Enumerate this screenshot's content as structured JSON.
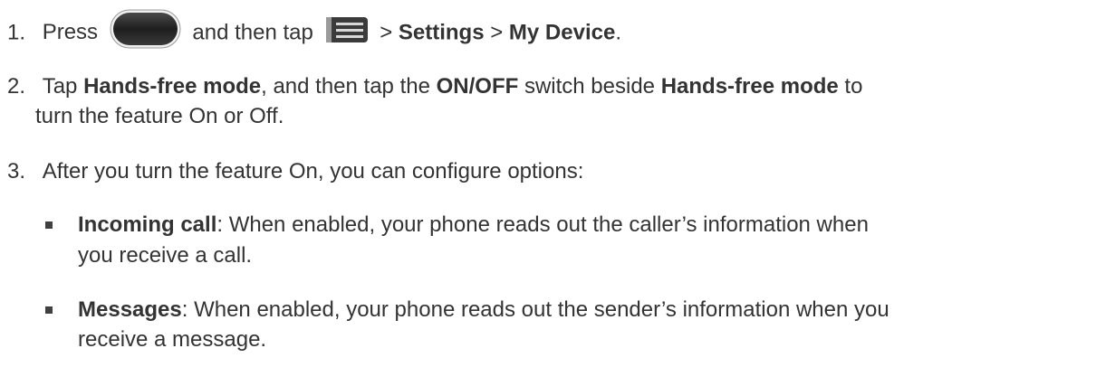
{
  "steps": [
    {
      "number": "1.",
      "seg1": "Press",
      "seg2": "and then tap",
      "seg3": ">",
      "settings": "Settings",
      "seg4": ">",
      "my_device": "My Device",
      "seg5": "."
    },
    {
      "number": "2.",
      "seg1": "Tap",
      "hands_free_mode_1": "Hands-free mode",
      "seg2": ", and then tap the",
      "on_off": "ON/OFF",
      "seg3": "switch beside",
      "hands_free_mode_2": "Hands-free mode",
      "seg4": "to",
      "line2": "turn the feature On or Off."
    },
    {
      "number": "3.",
      "text": "After you turn the feature On, you can configure options:"
    }
  ],
  "options": [
    {
      "term": "Incoming call",
      "desc_line1": ": When enabled, your phone reads out the caller’s information when",
      "desc_line2": "you receive a call."
    },
    {
      "term": "Messages",
      "desc_line1": ": When enabled, your phone reads out the sender’s information when you",
      "desc_line2": "receive a message."
    }
  ],
  "icons": {
    "home_key": "home-key-icon",
    "menu_key": "menu-key-icon"
  },
  "colors": {
    "text": "#333333",
    "bullet": "#404040",
    "key_fill": "#2a2a2a"
  }
}
